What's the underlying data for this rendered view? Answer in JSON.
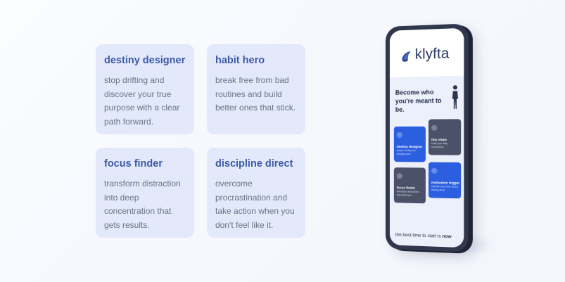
{
  "cards": [
    {
      "title": "destiny designer",
      "description": "stop drifting and discover your true purpose with a clear path forward."
    },
    {
      "title": "habit hero",
      "description": "break free from bad routines and build better ones that stick."
    },
    {
      "title": "focus finder",
      "description": "transform distraction into deep concentration that gets results."
    },
    {
      "title": "discipline direct",
      "description": "overcome procrastination and take action when you don't feel like it."
    }
  ],
  "phone": {
    "brand": "klyfta",
    "headline": "Become who you're meant to be.",
    "tiles": [
      {
        "title": "destiny designer",
        "description": "create the life you actually want"
      },
      {
        "title": "tiny steps",
        "description": "build your daily momentum"
      },
      {
        "title": "focus finder",
        "description": "eliminate distractions that derail you"
      },
      {
        "title": "motivation trigger",
        "description": "activate your drive when feeling stuck"
      }
    ],
    "footer_prefix": "the best time to start is ",
    "footer_emphasis": "now"
  },
  "colors": {
    "card_bg": "#e3e9fb",
    "card_title": "#3c5aa6",
    "card_text": "#6b7387",
    "phone_frame": "#30364b",
    "tile_blue": "#2c5fe0",
    "tile_dark": "#4b5168"
  },
  "icons": [
    "klyfta-logo-icon",
    "person-figure-icon",
    "tile-icon"
  ]
}
